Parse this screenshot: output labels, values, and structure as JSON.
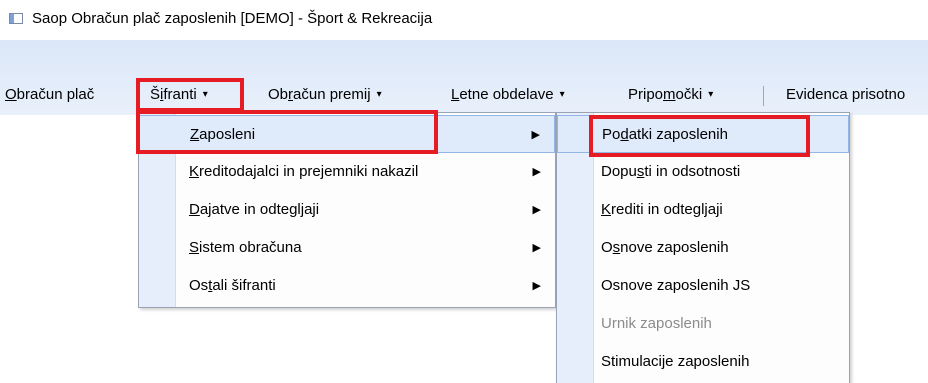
{
  "window": {
    "title": "Saop Obračun plač zaposlenih  [DEMO] - Šport & Rekreacija",
    "icon": "app-window-icon"
  },
  "menubar": {
    "items": [
      {
        "pre": "",
        "u": "O",
        "post": "bračun plač",
        "dropdown": false
      },
      {
        "pre": "Š",
        "u": "i",
        "post": "franti",
        "dropdown": true
      },
      {
        "pre": "Ob",
        "u": "r",
        "post": "ačun premij",
        "dropdown": true
      },
      {
        "pre": "",
        "u": "L",
        "post": "etne obdelave",
        "dropdown": true
      },
      {
        "pre": "Pripo",
        "u": "m",
        "post": "očki",
        "dropdown": true
      },
      {
        "pre": "Evidenca prisotno",
        "u": "",
        "post": "",
        "dropdown": false
      }
    ],
    "caret": "▾"
  },
  "sifranti_menu": {
    "items": [
      {
        "pre": "",
        "u": "Z",
        "post": "aposleni",
        "submenu": true,
        "highlighted": true
      },
      {
        "pre": "",
        "u": "K",
        "post": "reditodajalci in prejemniki nakazil",
        "submenu": true
      },
      {
        "pre": "",
        "u": "D",
        "post": "ajatve in odtegljaji",
        "submenu": true
      },
      {
        "pre": "",
        "u": "S",
        "post": "istem obračuna",
        "submenu": true
      },
      {
        "pre": "Os",
        "u": "t",
        "post": "ali šifranti",
        "submenu": true
      }
    ],
    "arrow": "▶"
  },
  "zaposleni_submenu": {
    "items": [
      {
        "pre": "Po",
        "u": "d",
        "post": "atki zaposlenih",
        "highlighted": true,
        "disabled": false
      },
      {
        "pre": "Dopu",
        "u": "s",
        "post": "ti in odsotnosti",
        "disabled": false
      },
      {
        "pre": "",
        "u": "K",
        "post": "rediti in odtegljaji",
        "disabled": false
      },
      {
        "pre": "O",
        "u": "s",
        "post": "nove zaposlenih",
        "disabled": false
      },
      {
        "pre": "Osnove zaposlenih JS",
        "u": "",
        "post": "",
        "disabled": false
      },
      {
        "pre": "Urnik zaposlenih",
        "u": "",
        "post": "",
        "disabled": true
      },
      {
        "pre": "Stimulacije zaposlenih",
        "u": "",
        "post": "",
        "disabled": false
      }
    ]
  },
  "colors": {
    "annotation_red": "#e51c23",
    "menu_hover": "#dfeafb",
    "ribbon_band": "#dbe7f8"
  }
}
